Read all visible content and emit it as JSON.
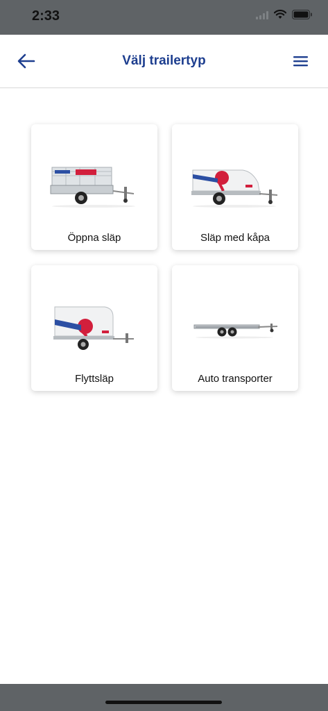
{
  "status_bar": {
    "time": "2:33",
    "icons": [
      "signal-icon",
      "wifi-icon",
      "battery-icon"
    ]
  },
  "header": {
    "title": "Välj trailertyp",
    "back_icon": "arrow-left-icon",
    "menu_icon": "hamburger-menu-icon"
  },
  "colors": {
    "accent": "#1d3e8f",
    "status_bar": "#5f6366",
    "brand_red": "#d21f3c"
  },
  "trailers": [
    {
      "label": "Öppna släp",
      "image": "open-trailer-image"
    },
    {
      "label": "Släp med kåpa",
      "image": "covered-trailer-image"
    },
    {
      "label": "Flyttsläp",
      "image": "moving-trailer-image"
    },
    {
      "label": "Auto transporter",
      "image": "car-transporter-image"
    }
  ]
}
